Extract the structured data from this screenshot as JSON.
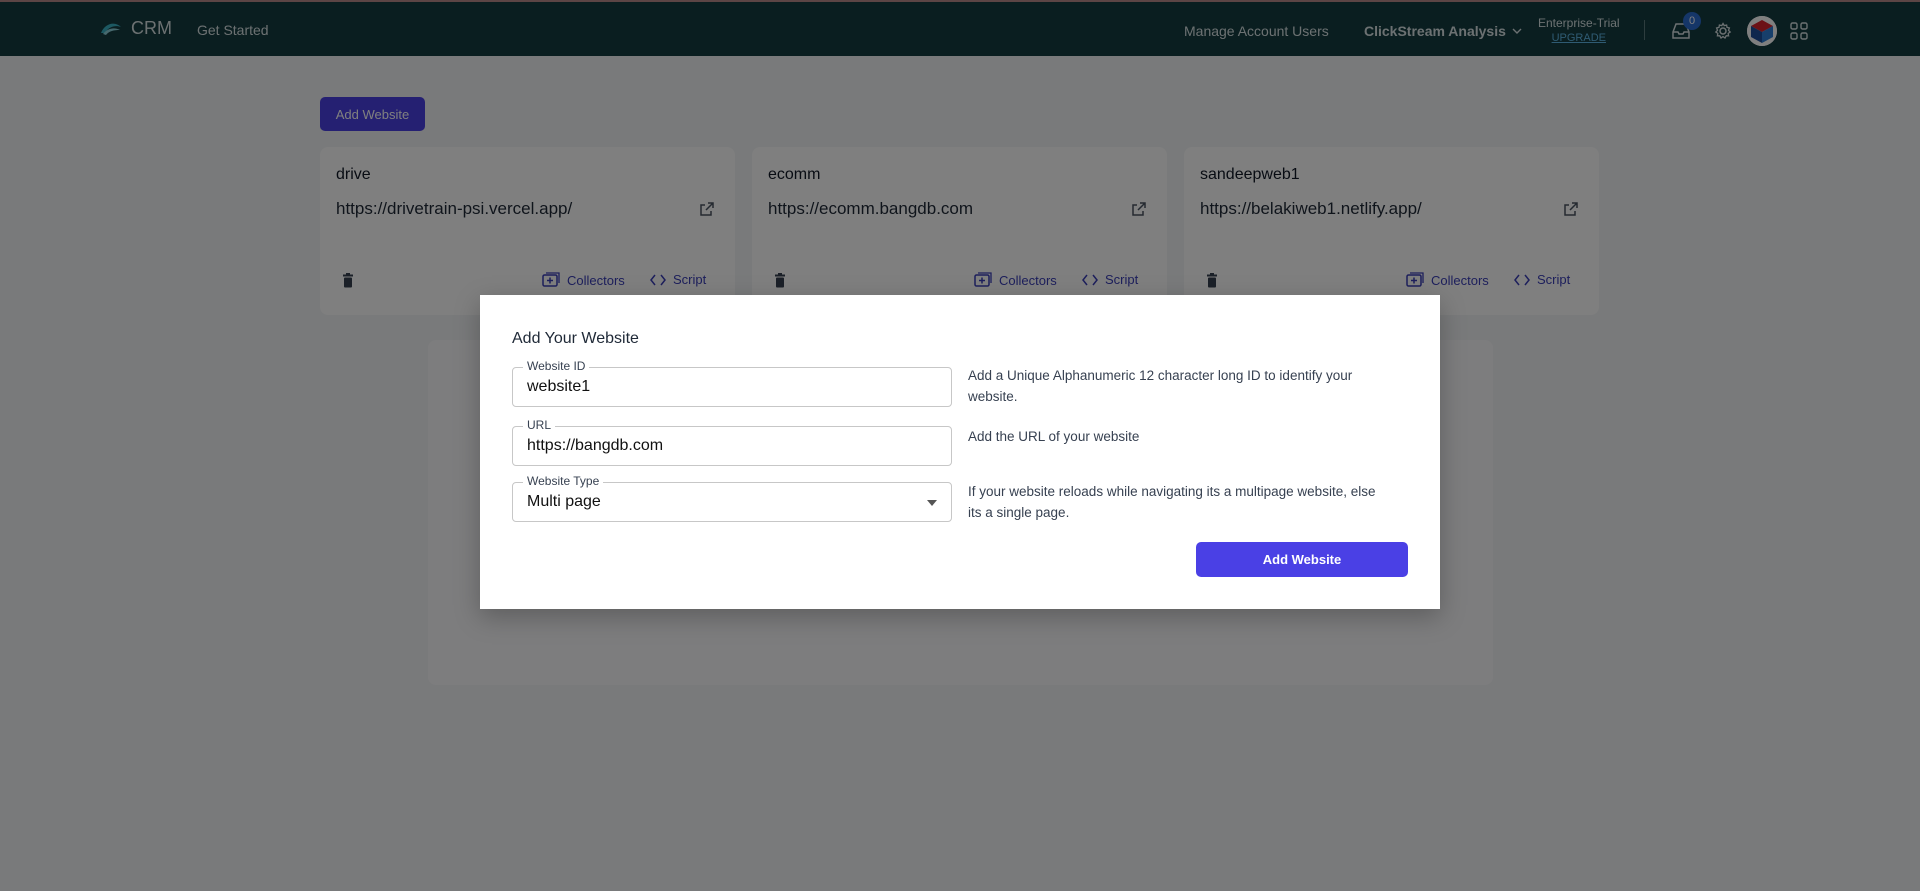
{
  "header": {
    "brand": "CRM",
    "get_started": "Get Started",
    "manage_users": "Manage Account Users",
    "clickstream": "ClickStream Analysis",
    "plan_name": "Enterprise-Trial",
    "upgrade": "UPGRADE",
    "notification_count": "0"
  },
  "toolbar": {
    "add_website": "Add Website"
  },
  "cards": [
    {
      "name": "drive",
      "url": "https://drivetrain-psi.vercel.app/",
      "collectors": "Collectors",
      "script": "Script"
    },
    {
      "name": "ecomm",
      "url": "https://ecomm.bangdb.com",
      "collectors": "Collectors",
      "script": "Script"
    },
    {
      "name": "sandeepweb1",
      "url": "https://belakiweb1.netlify.app/",
      "collectors": "Collectors",
      "script": "Script"
    }
  ],
  "modal": {
    "title": "Add Your Website",
    "website_id_label": "Website ID",
    "website_id_value": "website1",
    "website_id_hint": "Add a Unique Alphanumeric 12 character long ID to identify your website.",
    "url_label": "URL",
    "url_value": "https://bangdb.com",
    "url_hint": "Add the URL of your website",
    "type_label": "Website Type",
    "type_value": "Multi page",
    "type_hint": "If your website reloads while navigating its a multipage website, else its a single page.",
    "submit": "Add Website"
  },
  "colors": {
    "header_bg": "#143c40",
    "accent": "#4a40e5",
    "link": "#3b3fb8"
  }
}
